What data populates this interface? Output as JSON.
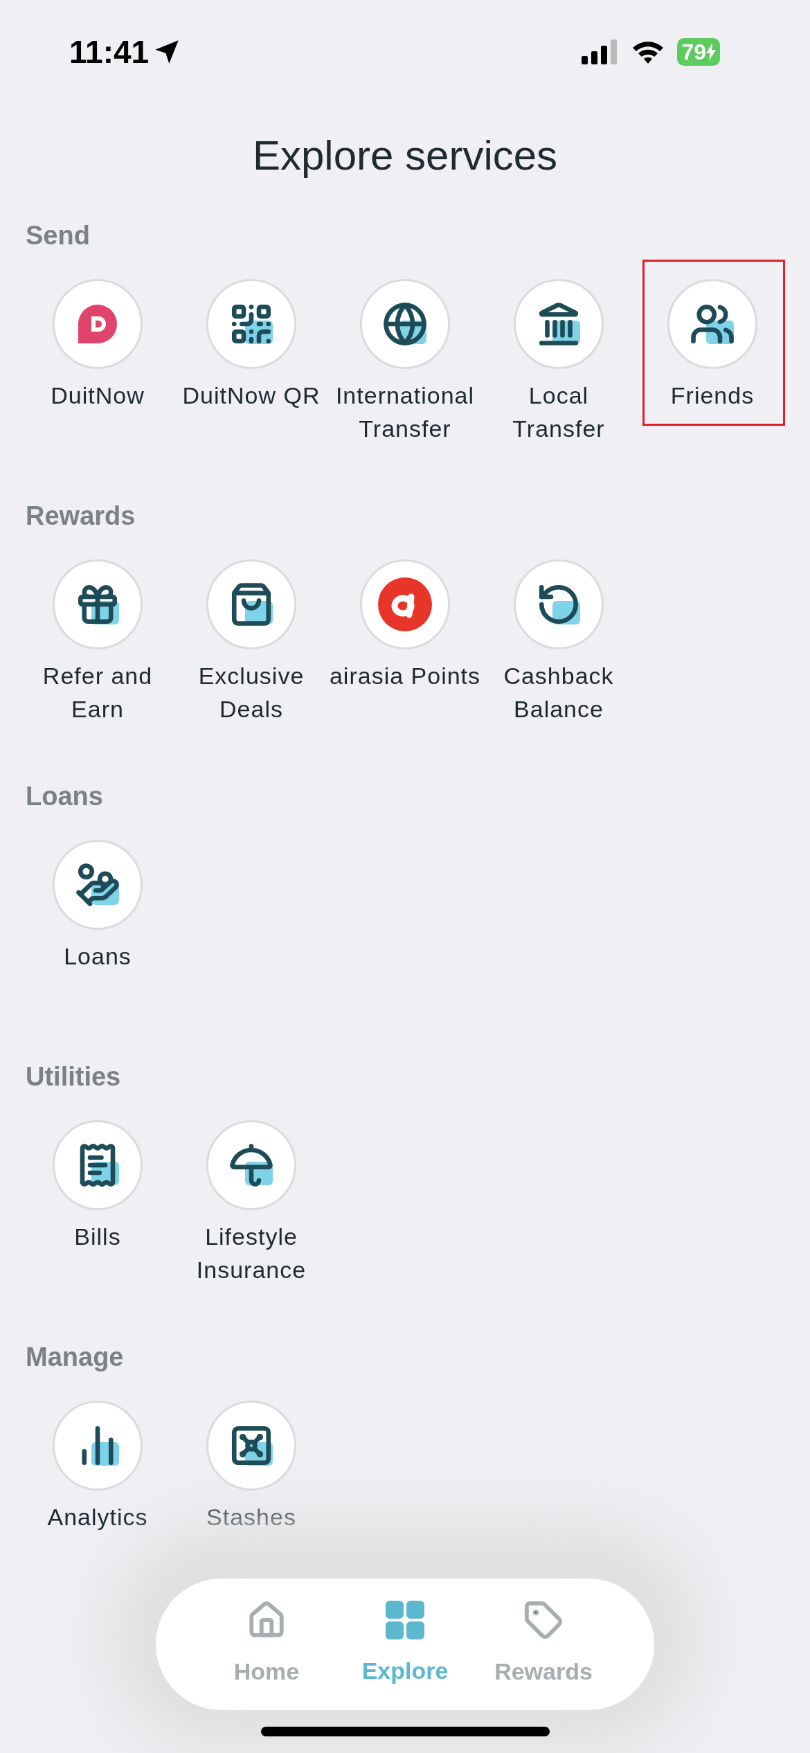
{
  "status_bar": {
    "time": "11:41",
    "battery": "79"
  },
  "title": "Explore services",
  "sections": [
    {
      "heading": "Send",
      "items": [
        {
          "label": "DuitNow",
          "highlighted": false
        },
        {
          "label": "DuitNow QR",
          "highlighted": false
        },
        {
          "label": "International Transfer",
          "highlighted": false
        },
        {
          "label": "Local Transfer",
          "highlighted": false
        },
        {
          "label": "Friends",
          "highlighted": true
        }
      ]
    },
    {
      "heading": "Rewards",
      "items": [
        {
          "label": "Refer and Earn",
          "highlighted": false
        },
        {
          "label": "Exclusive Deals",
          "highlighted": false
        },
        {
          "label": "airasia Points",
          "highlighted": false
        },
        {
          "label": "Cashback Balance",
          "highlighted": false
        }
      ]
    },
    {
      "heading": "Loans",
      "items": [
        {
          "label": "Loans",
          "highlighted": false
        }
      ]
    },
    {
      "heading": "Utilities",
      "items": [
        {
          "label": "Bills",
          "highlighted": false
        },
        {
          "label": "Lifestyle Insurance",
          "highlighted": false
        }
      ]
    },
    {
      "heading": "Manage",
      "items": [
        {
          "label": "Analytics",
          "highlighted": false
        },
        {
          "label": "Stashes",
          "highlighted": false
        }
      ]
    }
  ],
  "tab_bar": [
    {
      "label": "Home",
      "selected": false
    },
    {
      "label": "Explore",
      "selected": true
    },
    {
      "label": "Rewards",
      "selected": false
    }
  ]
}
